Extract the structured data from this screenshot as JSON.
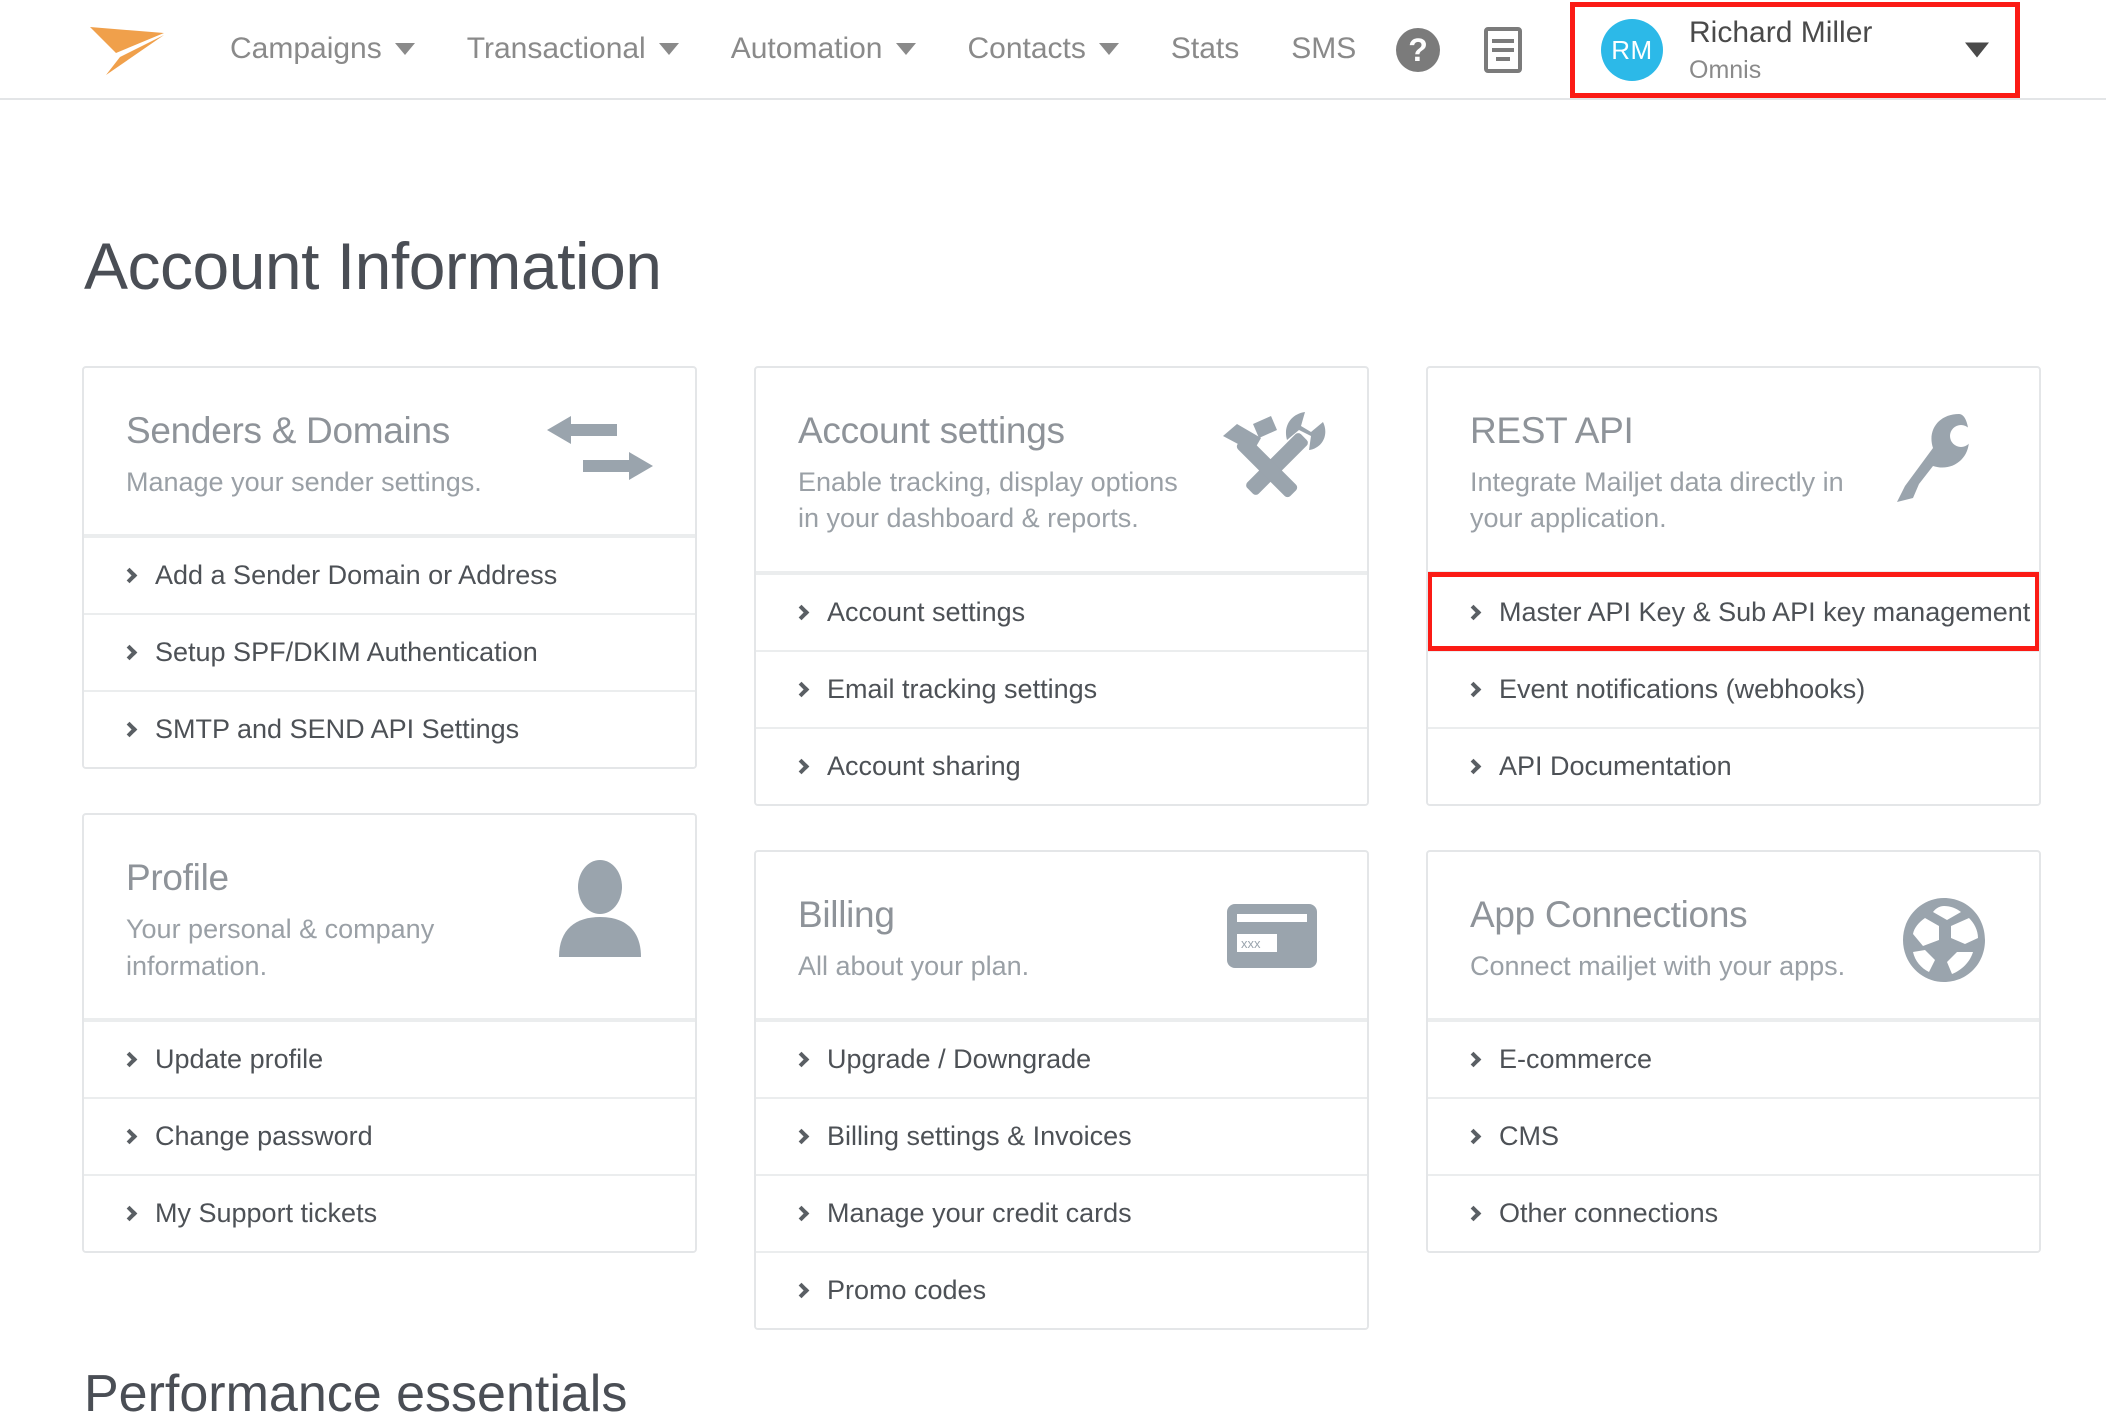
{
  "header": {
    "logo_icon": "mailjet-arrow-logo",
    "nav": [
      {
        "label": "Campaigns",
        "has_dropdown": true
      },
      {
        "label": "Transactional",
        "has_dropdown": true
      },
      {
        "label": "Automation",
        "has_dropdown": true
      },
      {
        "label": "Contacts",
        "has_dropdown": true
      },
      {
        "label": "Stats",
        "has_dropdown": false
      },
      {
        "label": "SMS",
        "has_dropdown": false
      }
    ],
    "help_icon": "question-mark-icon",
    "help_glyph": "?",
    "docs_icon": "document-icon",
    "user": {
      "initials": "RM",
      "name": "Richard Miller",
      "org": "Omnis",
      "avatar_color": "#2cb9e8",
      "highlight_color": "#fb1b15"
    }
  },
  "page": {
    "title": "Account Information",
    "cut_off_heading": "Performance essentials"
  },
  "cards": {
    "senders": {
      "title": "Senders & Domains",
      "subtitle": "Manage your sender settings.",
      "icon": "swap-arrows-icon",
      "links": [
        "Add a Sender Domain or Address",
        "Setup SPF/DKIM Authentication",
        "SMTP and SEND API Settings"
      ]
    },
    "profile": {
      "title": "Profile",
      "subtitle": "Your personal & company information.",
      "icon": "user-silhouette-icon",
      "links": [
        "Update profile",
        "Change password",
        "My Support tickets"
      ]
    },
    "account_settings": {
      "title": "Account settings",
      "subtitle": "Enable tracking, display options in your dashboard & reports.",
      "icon": "hammer-wrench-icon",
      "links": [
        "Account settings",
        "Email tracking settings",
        "Account sharing"
      ]
    },
    "billing": {
      "title": "Billing",
      "subtitle": "All about your plan.",
      "icon": "credit-card-icon",
      "links": [
        "Upgrade / Downgrade",
        "Billing settings & Invoices",
        "Manage your credit cards",
        "Promo codes"
      ]
    },
    "rest_api": {
      "title": "REST API",
      "subtitle": "Integrate Mailjet data directly in your application.",
      "icon": "key-icon",
      "links": [
        "Master API Key & Sub API key management",
        "Event notifications (webhooks)",
        "API Documentation"
      ],
      "highlighted_link_index": 0
    },
    "app_connections": {
      "title": "App Connections",
      "subtitle": "Connect mailjet with your apps.",
      "icon": "globe-network-icon",
      "links": [
        "E-commerce",
        "CMS",
        "Other connections"
      ]
    }
  }
}
